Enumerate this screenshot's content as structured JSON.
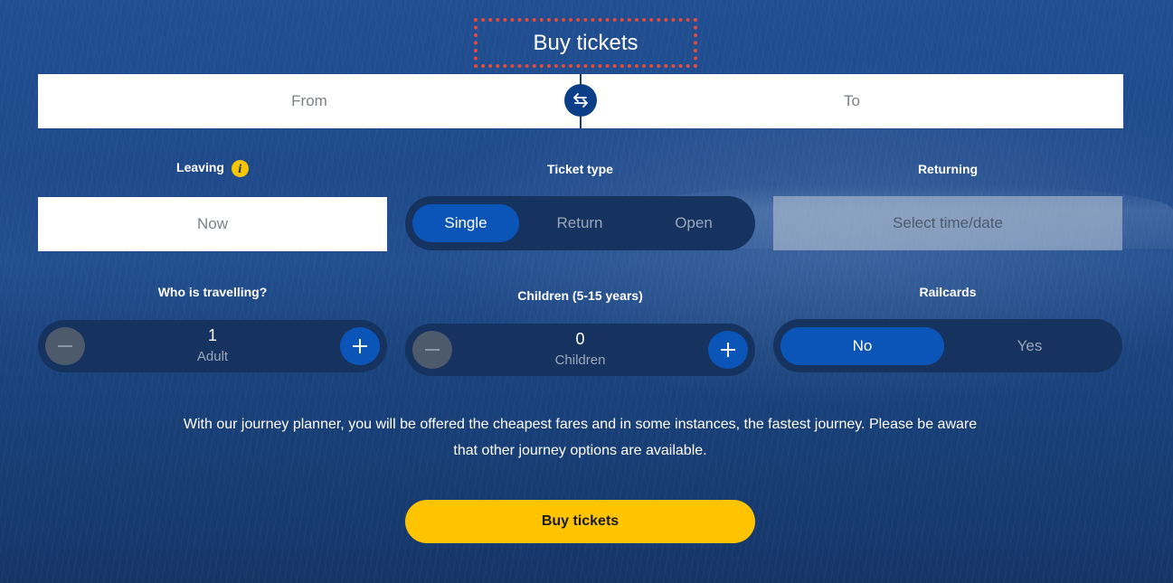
{
  "header": {
    "title": "Buy tickets"
  },
  "route": {
    "from_placeholder": "From",
    "to_placeholder": "To",
    "swap_icon": "swap-arrows-icon"
  },
  "leaving": {
    "label": "Leaving",
    "value": "Now",
    "info_icon": "info-icon",
    "info_glyph": "i"
  },
  "ticket_type": {
    "label": "Ticket type",
    "options": [
      "Single",
      "Return",
      "Open"
    ],
    "selected": "Single"
  },
  "returning": {
    "label": "Returning",
    "placeholder": "Select time/date"
  },
  "travellers": {
    "label": "Who is travelling?",
    "count": "1",
    "unit": "Adult"
  },
  "children": {
    "label": "Children (5-15 years)",
    "count": "0",
    "unit": "Children"
  },
  "railcards": {
    "label": "Railcards",
    "options": [
      "No",
      "Yes"
    ],
    "selected": "No"
  },
  "notice": {
    "text": "With our journey planner, you will be offered the cheapest fares and in some instances, the fastest journey. Please be aware that other journey options are available."
  },
  "cta": {
    "label": "Buy tickets"
  },
  "colors": {
    "accent": "#ffc400",
    "primary": "#0c55b8",
    "highlight": "#e24b3b"
  }
}
